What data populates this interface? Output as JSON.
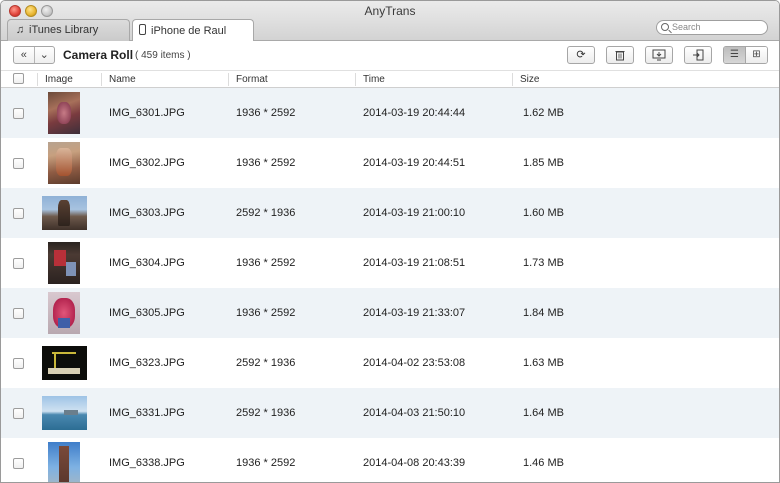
{
  "window": {
    "title": "AnyTrans"
  },
  "tabs": [
    {
      "label": "iTunes Library",
      "icon": "music-note-icon"
    },
    {
      "label": "iPhone de Raul",
      "icon": "iphone-icon"
    }
  ],
  "search": {
    "placeholder": "Search"
  },
  "toolbar": {
    "section_title": "Camera Roll",
    "item_count": "( 459 items )",
    "buttons": [
      "refresh-icon",
      "delete-icon",
      "to-computer-icon",
      "add-to-device-icon"
    ],
    "view_modes": [
      "list-view-icon",
      "grid-view-icon"
    ],
    "active_view": "list"
  },
  "table": {
    "columns": [
      "Image",
      "Name",
      "Format",
      "Time",
      "Size"
    ],
    "rows": [
      {
        "name": "IMG_6301.JPG",
        "format": "1936 * 2592",
        "time": "2014-03-19 20:44:44",
        "size": "1.62 MB"
      },
      {
        "name": "IMG_6302.JPG",
        "format": "1936 * 2592",
        "time": "2014-03-19 20:44:51",
        "size": "1.85 MB"
      },
      {
        "name": "IMG_6303.JPG",
        "format": "2592 * 1936",
        "time": "2014-03-19 21:00:10",
        "size": "1.60 MB"
      },
      {
        "name": "IMG_6304.JPG",
        "format": "1936 * 2592",
        "time": "2014-03-19 21:08:51",
        "size": "1.73 MB"
      },
      {
        "name": "IMG_6305.JPG",
        "format": "1936 * 2592",
        "time": "2014-03-19 21:33:07",
        "size": "1.84 MB"
      },
      {
        "name": "IMG_6323.JPG",
        "format": "2592 * 1936",
        "time": "2014-04-02 23:53:08",
        "size": "1.63 MB"
      },
      {
        "name": "IMG_6331.JPG",
        "format": "2592 * 1936",
        "time": "2014-04-03 21:50:10",
        "size": "1.64 MB"
      },
      {
        "name": "IMG_6338.JPG",
        "format": "1936 * 2592",
        "time": "2014-04-08 20:43:39",
        "size": "1.46 MB"
      }
    ]
  },
  "colors": {
    "row_alt": "#eef3f7",
    "titlebar": "#d3d3d3",
    "border": "#a6a6a6"
  }
}
